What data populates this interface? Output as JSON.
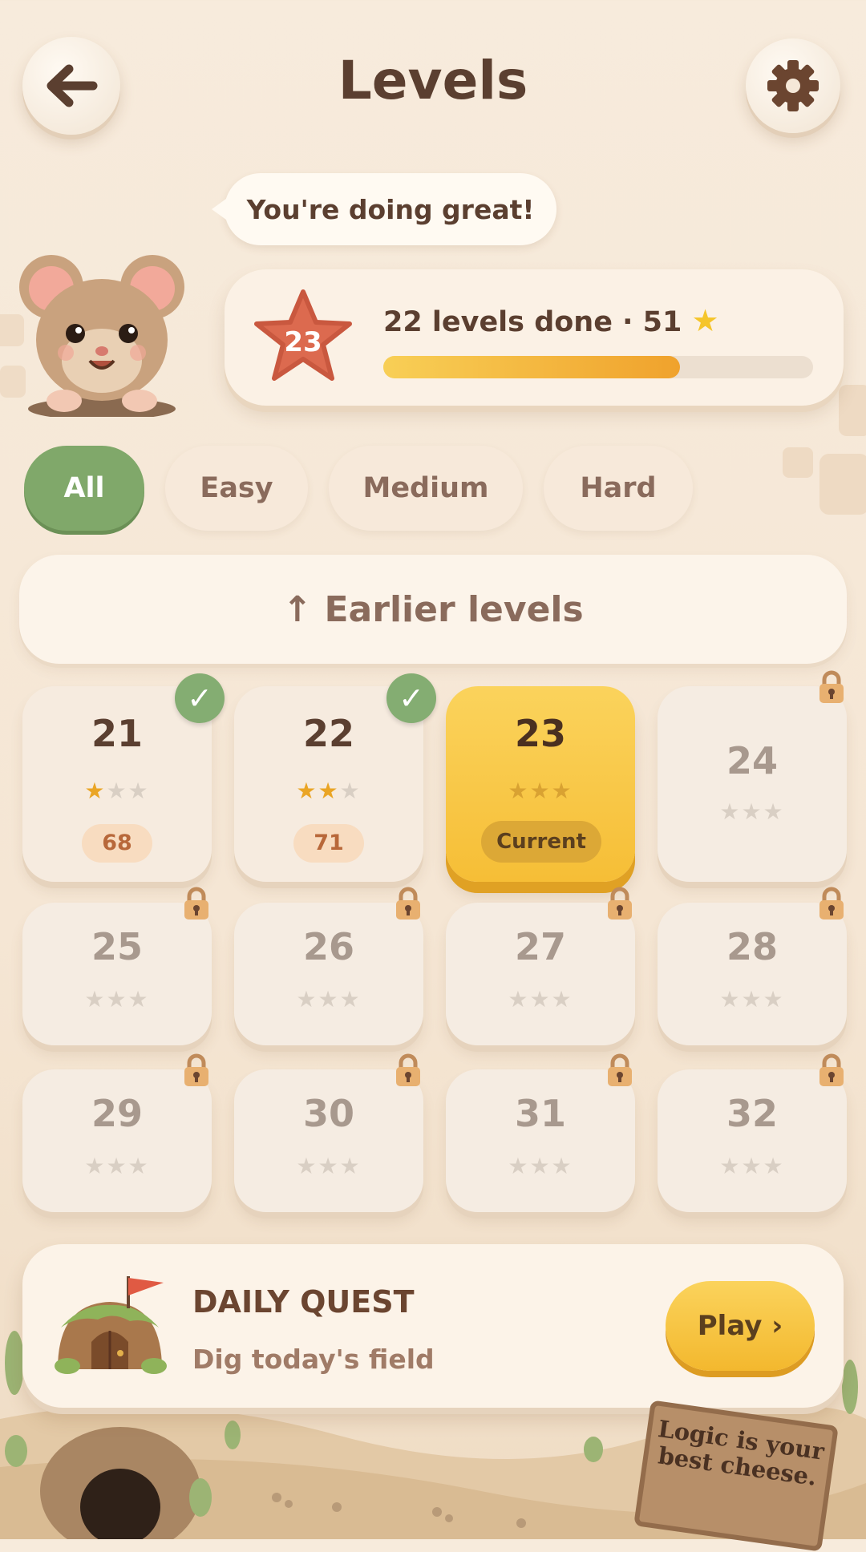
{
  "header": {
    "title": "Levels",
    "back_icon": "back-arrow-icon",
    "settings_icon": "gear-icon"
  },
  "mascot": {
    "speech": "You're doing great!"
  },
  "progress": {
    "current_level": "23",
    "text": "22 levels done · 51",
    "fraction": 0.69,
    "bar_colors": [
      "#f8cf56",
      "#f0a22c"
    ]
  },
  "filters": [
    {
      "label": "All",
      "active": true
    },
    {
      "label": "Easy",
      "active": false
    },
    {
      "label": "Medium",
      "active": false
    },
    {
      "label": "Hard",
      "active": false
    }
  ],
  "earlier": {
    "label": "↑ Earlier levels"
  },
  "levels": [
    {
      "number": "21",
      "stars": 1,
      "score": "68",
      "state": "done"
    },
    {
      "number": "22",
      "stars": 2,
      "score": "71",
      "state": "done"
    },
    {
      "number": "23",
      "stars": 0,
      "badge": "Current",
      "state": "current"
    },
    {
      "number": "24",
      "stars": 0,
      "state": "locked"
    },
    {
      "number": "25",
      "stars": 0,
      "state": "locked"
    },
    {
      "number": "26",
      "stars": 0,
      "state": "locked"
    },
    {
      "number": "27",
      "stars": 0,
      "state": "locked"
    },
    {
      "number": "28",
      "stars": 0,
      "state": "locked"
    },
    {
      "number": "29",
      "stars": 0,
      "state": "locked"
    },
    {
      "number": "30",
      "stars": 0,
      "state": "locked"
    },
    {
      "number": "31",
      "stars": 0,
      "state": "locked"
    },
    {
      "number": "32",
      "stars": 0,
      "state": "locked"
    }
  ],
  "quest": {
    "title": "DAILY QUEST",
    "subtitle": "Dig today's field",
    "button": "Play ›"
  },
  "sign": {
    "text": "Logic is your best cheese."
  },
  "colors": {
    "accent_green": "#80a86a",
    "accent_yellow": "#f6be36",
    "text_brown": "#5b3f30"
  }
}
